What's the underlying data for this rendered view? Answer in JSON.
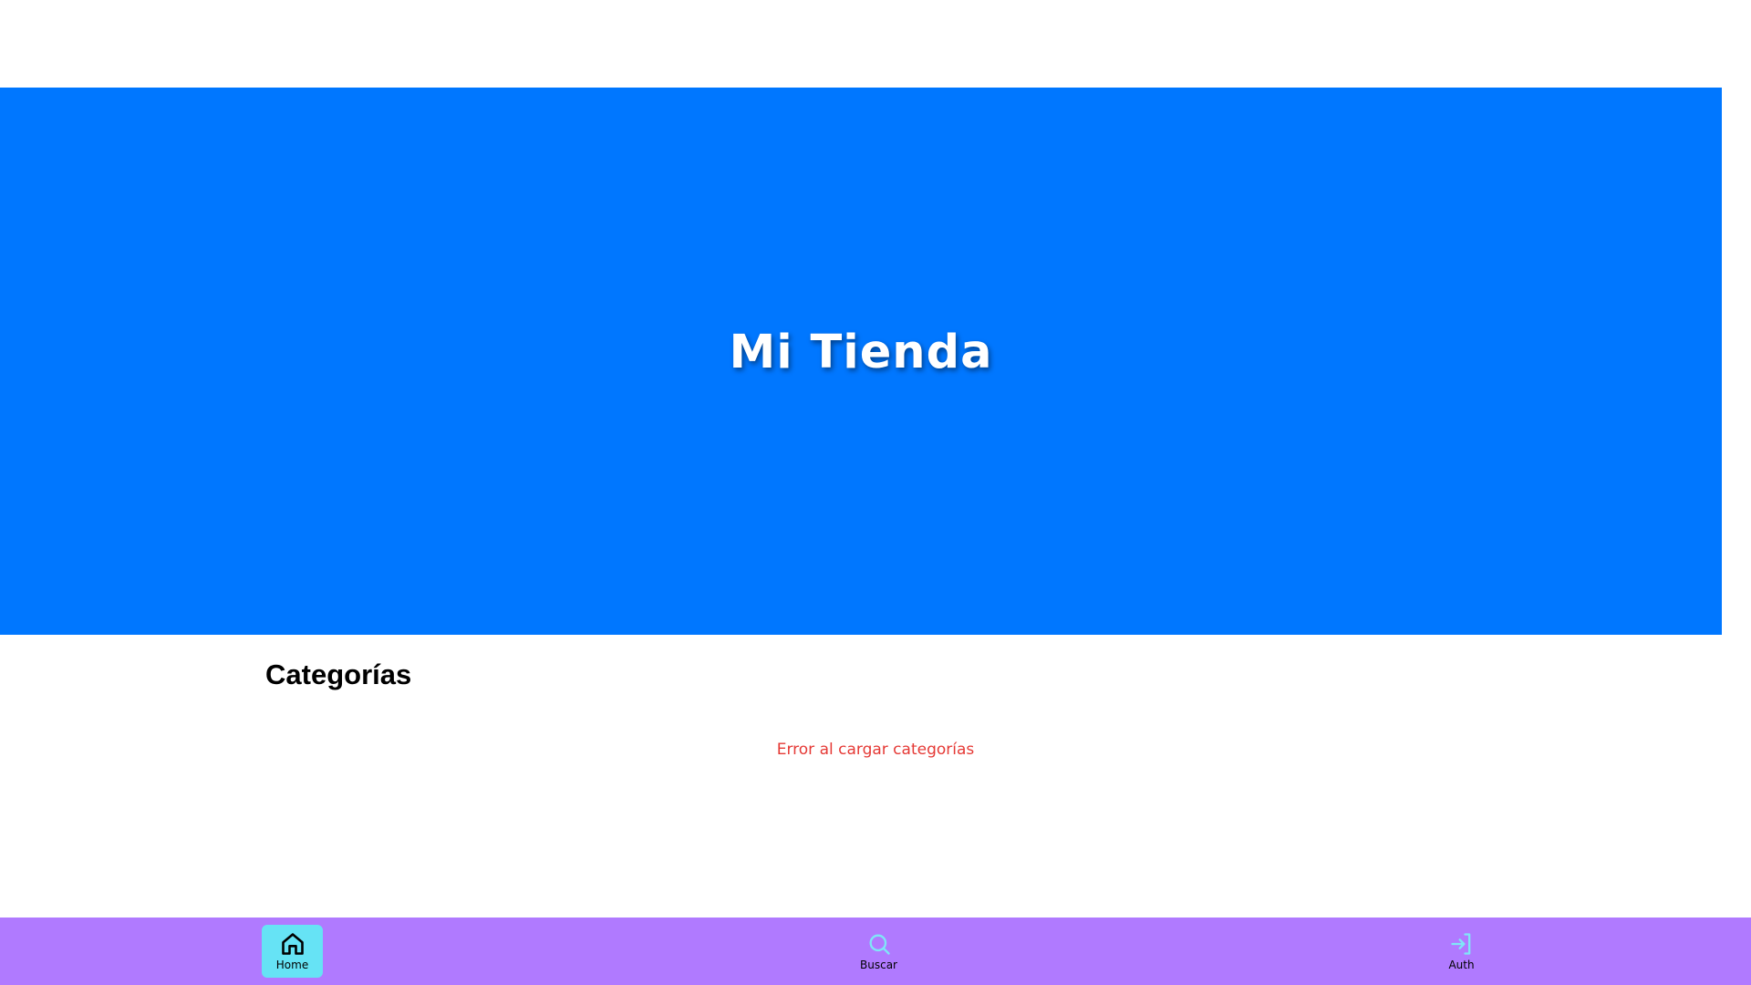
{
  "hero": {
    "title": "Mi Tienda",
    "background_color": "#0077ff"
  },
  "categories": {
    "title": "Categorías",
    "error_message": "Error al cargar categorías",
    "error_color": "#e53935"
  },
  "bottom_nav": {
    "background_color": "#b07aff",
    "active_color": "#66e3f5",
    "items": [
      {
        "label": "Home",
        "icon": "home-icon",
        "active": true
      },
      {
        "label": "Buscar",
        "icon": "search-icon",
        "active": false
      },
      {
        "label": "Auth",
        "icon": "login-icon",
        "active": false
      }
    ]
  }
}
